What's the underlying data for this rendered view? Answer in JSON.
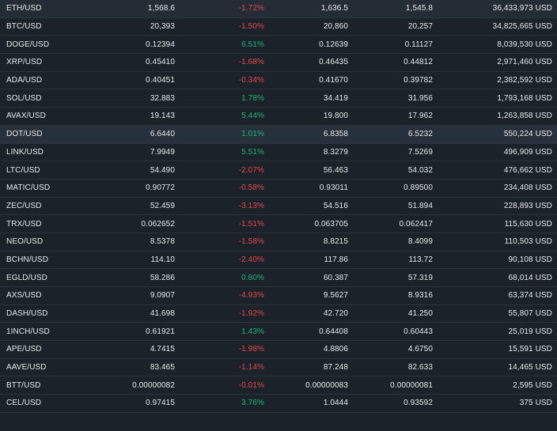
{
  "colors": {
    "background": "#1b2229",
    "row_highlight": "#27313b",
    "negative": "#e5484d",
    "positive": "#1fb67f",
    "text": "#e6e9ec"
  },
  "rows": [
    {
      "pair": "ETH/USD",
      "last": "1,568.6",
      "change": "-1.72%",
      "high": "1,636.5",
      "low": "1,545.8",
      "volume": "36,433,973 USD",
      "dir": "neg"
    },
    {
      "pair": "BTC/USD",
      "last": "20,393",
      "change": "-1.50%",
      "high": "20,860",
      "low": "20,257",
      "volume": "34,825,665 USD",
      "dir": "neg"
    },
    {
      "pair": "DOGE/USD",
      "last": "0.12394",
      "change": "6.51%",
      "high": "0.12639",
      "low": "0.11127",
      "volume": "8,039,530 USD",
      "dir": "pos"
    },
    {
      "pair": "XRP/USD",
      "last": "0.45410",
      "change": "-1.68%",
      "high": "0.46435",
      "low": "0.44812",
      "volume": "2,971,460 USD",
      "dir": "neg"
    },
    {
      "pair": "ADA/USD",
      "last": "0.40451",
      "change": "-0.34%",
      "high": "0.41670",
      "low": "0.39782",
      "volume": "2,382,592 USD",
      "dir": "neg"
    },
    {
      "pair": "SOL/USD",
      "last": "32.883",
      "change": "1.78%",
      "high": "34.419",
      "low": "31.956",
      "volume": "1,793,168 USD",
      "dir": "pos"
    },
    {
      "pair": "AVAX/USD",
      "last": "19.143",
      "change": "5.44%",
      "high": "19.800",
      "low": "17.962",
      "volume": "1,263,858 USD",
      "dir": "pos"
    },
    {
      "pair": "DOT/USD",
      "last": "6.6440",
      "change": "1.01%",
      "high": "6.8358",
      "low": "6.5232",
      "volume": "550,224 USD",
      "dir": "pos",
      "highlight": true
    },
    {
      "pair": "LINK/USD",
      "last": "7.9949",
      "change": "5.51%",
      "high": "8.3279",
      "low": "7.5269",
      "volume": "496,909 USD",
      "dir": "pos"
    },
    {
      "pair": "LTC/USD",
      "last": "54.490",
      "change": "-2.07%",
      "high": "56.463",
      "low": "54.032",
      "volume": "476,662 USD",
      "dir": "neg"
    },
    {
      "pair": "MATIC/USD",
      "last": "0.90772",
      "change": "-0.58%",
      "high": "0.93011",
      "low": "0.89500",
      "volume": "234,408 USD",
      "dir": "neg"
    },
    {
      "pair": "ZEC/USD",
      "last": "52.459",
      "change": "-3.13%",
      "high": "54.516",
      "low": "51.894",
      "volume": "228,893 USD",
      "dir": "neg"
    },
    {
      "pair": "TRX/USD",
      "last": "0.062652",
      "change": "-1.51%",
      "high": "0.063705",
      "low": "0.062417",
      "volume": "115,630 USD",
      "dir": "neg"
    },
    {
      "pair": "NEO/USD",
      "last": "8.5378",
      "change": "-1.58%",
      "high": "8.8215",
      "low": "8.4099",
      "volume": "110,503 USD",
      "dir": "neg"
    },
    {
      "pair": "BCHN/USD",
      "last": "114.10",
      "change": "-2.40%",
      "high": "117.86",
      "low": "113.72",
      "volume": "90,108 USD",
      "dir": "neg"
    },
    {
      "pair": "EGLD/USD",
      "last": "58.286",
      "change": "0.80%",
      "high": "60.387",
      "low": "57.319",
      "volume": "68,014 USD",
      "dir": "pos"
    },
    {
      "pair": "AXS/USD",
      "last": "9.0907",
      "change": "-4.93%",
      "high": "9.5627",
      "low": "8.9316",
      "volume": "63,374 USD",
      "dir": "neg"
    },
    {
      "pair": "DASH/USD",
      "last": "41.698",
      "change": "-1.92%",
      "high": "42.720",
      "low": "41.250",
      "volume": "55,807 USD",
      "dir": "neg"
    },
    {
      "pair": "1INCH/USD",
      "last": "0.61921",
      "change": "1.43%",
      "high": "0.64408",
      "low": "0.60443",
      "volume": "25,019 USD",
      "dir": "pos"
    },
    {
      "pair": "APE/USD",
      "last": "4.7415",
      "change": "-1.98%",
      "high": "4.8806",
      "low": "4.6750",
      "volume": "15,591 USD",
      "dir": "neg"
    },
    {
      "pair": "AAVE/USD",
      "last": "83.465",
      "change": "-1.14%",
      "high": "87.248",
      "low": "82.633",
      "volume": "14,465 USD",
      "dir": "neg"
    },
    {
      "pair": "BTT/USD",
      "last": "0.00000082",
      "change": "-0.01%",
      "high": "0.00000083",
      "low": "0.00000081",
      "volume": "2,595 USD",
      "dir": "neg"
    },
    {
      "pair": "CEL/USD",
      "last": "0.97415",
      "change": "3.76%",
      "high": "1.0444",
      "low": "0.93592",
      "volume": "375 USD",
      "dir": "pos"
    }
  ]
}
